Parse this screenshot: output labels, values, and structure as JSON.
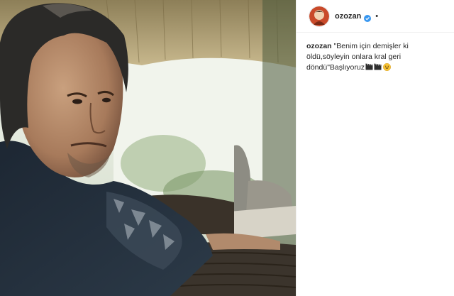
{
  "header": {
    "username": "ozozan",
    "separator": "•",
    "verified_color": "#3897f0"
  },
  "caption": {
    "username": "ozozan",
    "text": "\"Benim için demişler ki öldü,söyleyin onlara kral geri döndü\"Başlıyoruz",
    "emojis": [
      "clapper-board-emoji",
      "clapper-board-emoji",
      "grinning-face-emoji"
    ]
  },
  "photo": {
    "subject": "man-portrait-photo"
  }
}
